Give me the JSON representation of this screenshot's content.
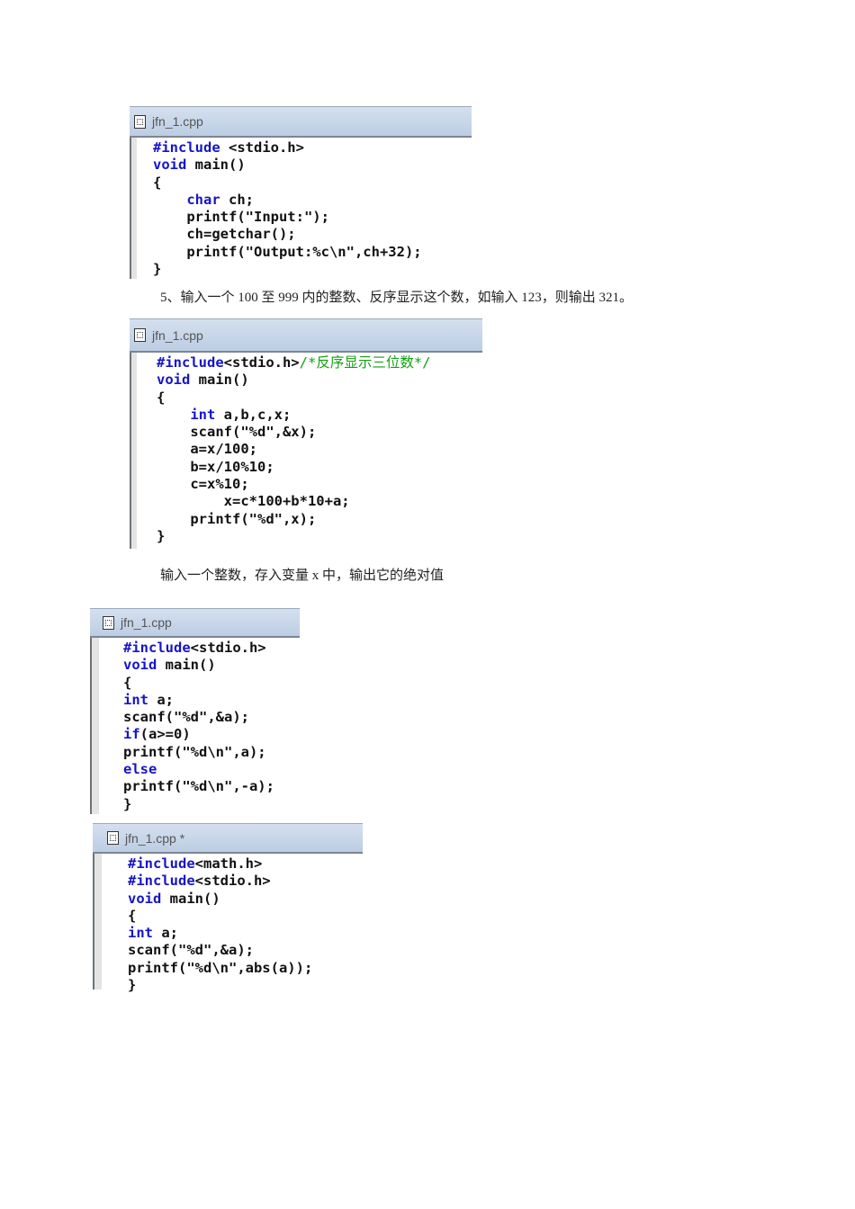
{
  "paragraphs": [
    "5、输入一个 100 至 999 内的整数、反序显示这个数，如输入 123，则输出 321。",
    "输入一个整数，存入变量 x 中，输出它的绝对值"
  ],
  "panels": [
    {
      "title": "jfn_1.cpp",
      "lines": [
        [
          [
            "kw",
            "#include"
          ],
          [
            "n",
            " <stdio.h>"
          ]
        ],
        [
          [
            "kw",
            "void"
          ],
          [
            "n",
            " main()"
          ]
        ],
        [
          [
            "n",
            "{"
          ]
        ],
        [
          [
            "n",
            "    "
          ],
          [
            "kw",
            "char"
          ],
          [
            "n",
            " ch;"
          ]
        ],
        [
          [
            "n",
            "    printf(\"Input:\");"
          ]
        ],
        [
          [
            "n",
            "    ch=getchar();"
          ]
        ],
        [
          [
            "n",
            "    printf(\"Output:%c\\n\",ch+32);"
          ]
        ],
        [
          [
            "n",
            "}"
          ]
        ]
      ]
    },
    {
      "title": "jfn_1.cpp",
      "lines": [
        [
          [
            "kw",
            "#include"
          ],
          [
            "n",
            "<stdio.h>"
          ],
          [
            "cm",
            "/*反序显示三位数*/"
          ]
        ],
        [
          [
            "kw",
            "void"
          ],
          [
            "n",
            " main()"
          ]
        ],
        [
          [
            "n",
            "{"
          ]
        ],
        [
          [
            "n",
            "    "
          ],
          [
            "kw",
            "int"
          ],
          [
            "n",
            " a,b,c,x;"
          ]
        ],
        [
          [
            "n",
            "    scanf(\"%d\",&x);"
          ]
        ],
        [
          [
            "n",
            "    a=x/100;"
          ]
        ],
        [
          [
            "n",
            "    b=x/10%10;"
          ]
        ],
        [
          [
            "n",
            "    c=x%10;"
          ]
        ],
        [
          [
            "n",
            "        x=c*100+b*10+a;"
          ]
        ],
        [
          [
            "n",
            "    printf(\"%d\",x);"
          ]
        ],
        [
          [
            "n",
            "}"
          ]
        ]
      ]
    },
    {
      "title": "jfn_1.cpp",
      "lines": [
        [
          [
            "kw",
            "#include"
          ],
          [
            "n",
            "<stdio.h>"
          ]
        ],
        [
          [
            "kw",
            "void"
          ],
          [
            "n",
            " main()"
          ]
        ],
        [
          [
            "n",
            "{"
          ]
        ],
        [
          [
            "kw",
            "int"
          ],
          [
            "n",
            " a;"
          ]
        ],
        [
          [
            "n",
            "scanf(\"%d\",&a);"
          ]
        ],
        [
          [
            "kw",
            "if"
          ],
          [
            "n",
            "(a>=0)"
          ]
        ],
        [
          [
            "n",
            "printf(\"%d\\n\",a);"
          ]
        ],
        [
          [
            "kw",
            "else"
          ]
        ],
        [
          [
            "n",
            "printf(\"%d\\n\",-a);"
          ]
        ],
        [
          [
            "n",
            "}"
          ]
        ]
      ]
    },
    {
      "title": "jfn_1.cpp *",
      "lines": [
        [
          [
            "kw",
            "#include"
          ],
          [
            "n",
            "<math.h>"
          ]
        ],
        [
          [
            "kw",
            "#include"
          ],
          [
            "n",
            "<stdio.h>"
          ]
        ],
        [
          [
            "kw",
            "void"
          ],
          [
            "n",
            " main()"
          ]
        ],
        [
          [
            "n",
            "{"
          ]
        ],
        [
          [
            "kw",
            "int"
          ],
          [
            "n",
            " a;"
          ]
        ],
        [
          [
            "n",
            "scanf(\"%d\",&a);"
          ]
        ],
        [
          [
            "n",
            "printf(\"%d\\n\",abs(a));"
          ]
        ],
        [
          [
            "n",
            "}"
          ]
        ]
      ]
    }
  ]
}
